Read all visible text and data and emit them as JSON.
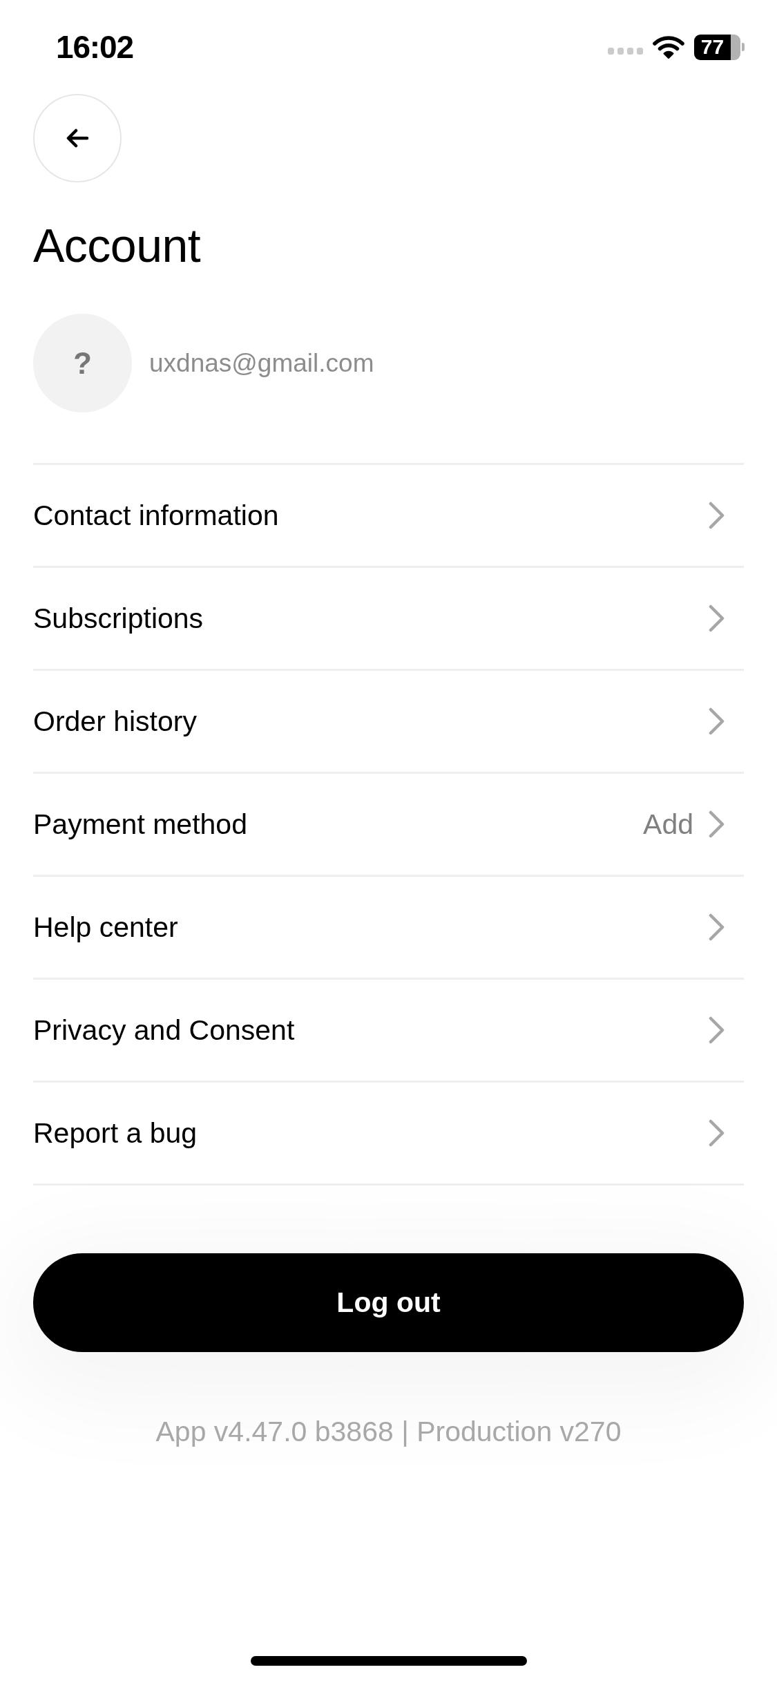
{
  "status_bar": {
    "time": "16:02",
    "battery": "77"
  },
  "title": "Account",
  "profile": {
    "avatar": "?",
    "email": "uxdnas@gmail.com"
  },
  "menu_items": [
    {
      "label": "Contact information"
    },
    {
      "label": "Subscriptions"
    },
    {
      "label": "Order history"
    },
    {
      "label": "Payment method",
      "value": "Add"
    },
    {
      "label": "Help center"
    },
    {
      "label": "Privacy and Consent"
    },
    {
      "label": "Report a bug"
    }
  ],
  "logout_button": "Log out",
  "version": "App v4.47.0 b3868 | Production v270"
}
